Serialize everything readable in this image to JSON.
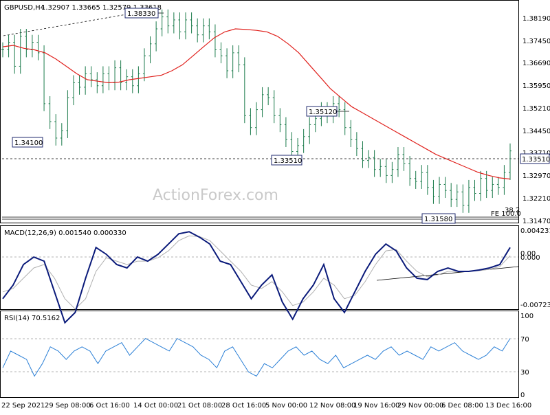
{
  "header": {
    "symbol": "GBPUSD,H4",
    "ohlc": "1.32907 1.33665 1.32579 1.33618",
    "macd": "MACD(12,26,9) 0.001540 0.000330",
    "rsi": "RSI(14) 70.5162"
  },
  "watermark": "ActionForex.com",
  "chart_data": [
    {
      "type": "line",
      "name": "price",
      "y_axis_labels": [
        "1.38190",
        "1.37450",
        "1.36690",
        "1.35950",
        "1.35210",
        "1.34450",
        "1.33710",
        "1.32970",
        "1.32210",
        "1.31470"
      ],
      "ylim": [
        1.3127,
        1.3855
      ],
      "series": [
        {
          "name": "GBPUSD",
          "color": "#1a7a4a",
          "values": [
            1.37,
            1.3725,
            1.3645,
            1.3745,
            1.37,
            1.3725,
            1.369,
            1.352,
            1.346,
            1.3405,
            1.343,
            1.354,
            1.359,
            1.3575,
            1.362,
            1.36,
            1.358,
            1.362,
            1.359,
            1.364,
            1.359,
            1.361,
            1.358,
            1.362,
            1.368,
            1.372,
            1.377,
            1.381,
            1.378,
            1.38,
            1.376,
            1.38,
            1.378,
            1.375,
            1.378,
            1.376,
            1.37,
            1.368,
            1.363,
            1.369,
            1.365,
            1.348,
            1.344,
            1.35,
            1.355,
            1.354,
            1.348,
            1.345,
            1.34,
            1.336,
            1.338,
            1.341,
            1.345,
            1.347,
            1.35,
            1.348,
            1.352,
            1.35,
            1.344,
            1.34,
            1.337,
            1.333,
            1.334,
            1.33,
            1.331,
            1.328,
            1.33,
            1.335,
            1.332,
            1.327,
            1.326,
            1.329,
            1.324,
            1.321,
            1.325,
            1.323,
            1.32,
            1.3225,
            1.318,
            1.324,
            1.322,
            1.327,
            1.323,
            1.325,
            1.324,
            1.329,
            1.3362
          ]
        },
        {
          "name": "MA",
          "color": "#e0201c",
          "values": [
            1.371,
            1.3715,
            1.3705,
            1.37,
            1.369,
            1.367,
            1.3645,
            1.362,
            1.36,
            1.3595,
            1.359,
            1.3592,
            1.36,
            1.3605,
            1.361,
            1.3615,
            1.363,
            1.365,
            1.368,
            1.371,
            1.374,
            1.376,
            1.377,
            1.3768,
            1.3765,
            1.376,
            1.3745,
            1.372,
            1.369,
            1.365,
            1.361,
            1.357,
            1.354,
            1.351,
            1.349,
            1.347,
            1.345,
            1.343,
            1.341,
            1.339,
            1.337,
            1.335,
            1.3335,
            1.332,
            1.3305,
            1.329,
            1.328,
            1.3272,
            1.3268
          ]
        }
      ],
      "annotations": [
        "1.38330",
        "1.34100",
        "1.35120",
        "1.33510",
        "1.31580",
        "1.33510",
        "FE 100.0",
        "38.2"
      ]
    },
    {
      "type": "line",
      "name": "macd",
      "y_axis_labels": [
        "0.004231",
        "0.00",
        "0.000",
        "-0.00723"
      ],
      "series": [
        {
          "name": "MACD",
          "color": "#0a1a7a",
          "values": [
            -0.006,
            -0.004,
            -0.001,
            0.0001,
            -0.0005,
            -0.005,
            -0.0095,
            -0.008,
            -0.003,
            0.0015,
            0.0005,
            -0.001,
            -0.0015,
            0.0001,
            -0.0005,
            0.0005,
            0.002,
            0.0035,
            0.0038,
            0.003,
            0.002,
            -0.0005,
            -0.001,
            -0.0035,
            -0.006,
            -0.004,
            -0.0025,
            -0.0065,
            -0.009,
            -0.006,
            -0.004,
            -0.001,
            -0.006,
            -0.008,
            -0.005,
            -0.002,
            0.0005,
            0.002,
            0.001,
            -0.0015,
            -0.003,
            -0.0032,
            -0.002,
            -0.0015,
            -0.002,
            -0.002,
            -0.0018,
            -0.0015,
            -0.001,
            0.0015
          ]
        },
        {
          "name": "Signal",
          "color": "#b0b0b0",
          "values": [
            -0.005,
            -0.0045,
            -0.003,
            -0.0015,
            -0.001,
            -0.003,
            -0.006,
            -0.0075,
            -0.006,
            -0.002,
            0.0,
            -0.0005,
            -0.001,
            -0.0005,
            -0.0005,
            0.0,
            0.001,
            0.0025,
            0.0032,
            0.0031,
            0.0025,
            0.001,
            -0.0005,
            -0.002,
            -0.004,
            -0.0045,
            -0.0035,
            -0.005,
            -0.007,
            -0.0065,
            -0.005,
            -0.003,
            -0.004,
            -0.006,
            -0.0055,
            -0.0035,
            -0.001,
            0.001,
            0.0012,
            -0.0005,
            -0.002,
            -0.0028,
            -0.0025,
            -0.002,
            -0.002,
            -0.002,
            -0.0019,
            -0.0017,
            -0.0013,
            0.0003
          ]
        }
      ]
    },
    {
      "type": "line",
      "name": "rsi",
      "y_axis_labels": [
        "100",
        "70",
        "30",
        "0"
      ],
      "ylim": [
        0,
        100
      ],
      "series": [
        {
          "name": "RSI",
          "color": "#2a7fd6",
          "values": [
            35,
            55,
            50,
            45,
            25,
            40,
            60,
            55,
            45,
            55,
            60,
            55,
            40,
            55,
            60,
            65,
            50,
            60,
            70,
            65,
            60,
            55,
            70,
            65,
            60,
            50,
            45,
            35,
            55,
            60,
            45,
            30,
            25,
            40,
            35,
            45,
            55,
            60,
            50,
            55,
            45,
            40,
            50,
            35,
            40,
            45,
            50,
            45,
            55,
            60,
            50,
            55,
            50,
            45,
            60,
            55,
            60,
            65,
            55,
            50,
            45,
            50,
            60,
            55,
            70
          ]
        }
      ]
    }
  ],
  "x_axis_labels": [
    "22 Sep 2021",
    "29 Sep 08:00",
    "6 Oct 16:00",
    "14 Oct 00:00",
    "21 Oct 08:00",
    "28 Oct 16:00",
    "5 Nov 00:00",
    "12 Nov 08:00",
    "19 Nov 16:00",
    "29 Nov 00:00",
    "6 Dec 08:00",
    "13 Dec 16:00"
  ]
}
